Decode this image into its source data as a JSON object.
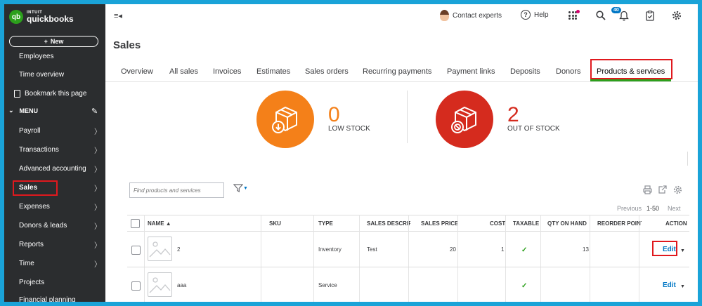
{
  "brand": {
    "intuit": "INTUIT",
    "product": "quickbooks",
    "logo": "qb"
  },
  "sidebar": {
    "new_label": "New",
    "items": [
      {
        "label": "Employees"
      },
      {
        "label": "Time overview"
      },
      {
        "label": "Bookmark this page"
      },
      {
        "label": "Payroll"
      },
      {
        "label": "Transactions"
      },
      {
        "label": "Advanced accounting"
      },
      {
        "label": "Sales"
      },
      {
        "label": "Expenses"
      },
      {
        "label": "Donors & leads"
      },
      {
        "label": "Reports"
      },
      {
        "label": "Time"
      },
      {
        "label": "Projects"
      },
      {
        "label": "Financial planning"
      }
    ],
    "menu_label": "MENU"
  },
  "topbar": {
    "contact_label": "Contact experts",
    "help_label": "Help",
    "notification_count": "40"
  },
  "page": {
    "title": "Sales",
    "tabs": [
      {
        "label": "Overview"
      },
      {
        "label": "All sales"
      },
      {
        "label": "Invoices"
      },
      {
        "label": "Estimates"
      },
      {
        "label": "Sales orders"
      },
      {
        "label": "Recurring payments"
      },
      {
        "label": "Payment links"
      },
      {
        "label": "Deposits"
      },
      {
        "label": "Donors"
      },
      {
        "label": "Products & services"
      }
    ],
    "active_tab": "Products & services"
  },
  "stock": {
    "low": {
      "count": "0",
      "label": "LOW STOCK",
      "color": "#f48019"
    },
    "out": {
      "count": "2",
      "label": "OUT OF STOCK",
      "color": "#d52b1e"
    }
  },
  "search": {
    "placeholder": "Find products and services"
  },
  "pagination": {
    "previous": "Previous",
    "range": "1-50",
    "next": "Next"
  },
  "table": {
    "columns": [
      "NAME ▲",
      "SKU",
      "TYPE",
      "SALES DESCRIPTION",
      "SALES PRICE",
      "COST",
      "TAXABLE",
      "QTY ON HAND",
      "REORDER POINT",
      "ACTION"
    ],
    "rows": [
      {
        "name": "2",
        "sku": "",
        "type": "Inventory",
        "description": "Test",
        "price": "20",
        "cost": "1",
        "taxable": true,
        "qty": "13",
        "reorder": "",
        "action": "Edit"
      },
      {
        "name": "aaa",
        "sku": "",
        "type": "Service",
        "description": "",
        "price": "",
        "cost": "",
        "taxable": true,
        "qty": "",
        "reorder": "",
        "action": "Edit"
      }
    ]
  },
  "colors": {
    "brand_green": "#2ca01c",
    "link_blue": "#0077c5",
    "highlight_red": "#e0191e",
    "sidebar_bg": "#2b2d2f"
  }
}
